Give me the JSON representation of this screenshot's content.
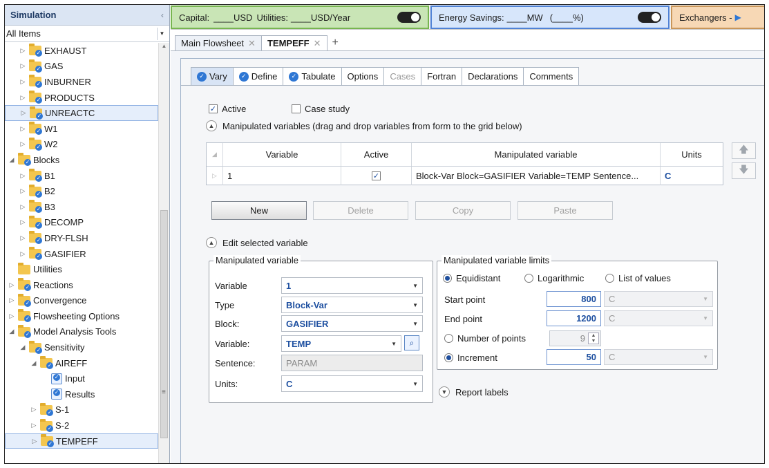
{
  "sidebar": {
    "title": "Simulation",
    "filter": "All Items",
    "tree": [
      {
        "label": "EXHAUST",
        "indent": 1,
        "expander": "▷",
        "icon": "folder-check"
      },
      {
        "label": "GAS",
        "indent": 1,
        "expander": "▷",
        "icon": "folder-check"
      },
      {
        "label": "INBURNER",
        "indent": 1,
        "expander": "▷",
        "icon": "folder-check"
      },
      {
        "label": "PRODUCTS",
        "indent": 1,
        "expander": "▷",
        "icon": "folder-check"
      },
      {
        "label": "UNREACTC",
        "indent": 1,
        "expander": "▷",
        "icon": "folder-check",
        "selected": true
      },
      {
        "label": "W1",
        "indent": 1,
        "expander": "▷",
        "icon": "folder-check"
      },
      {
        "label": "W2",
        "indent": 1,
        "expander": "▷",
        "icon": "folder-check"
      },
      {
        "label": "Blocks",
        "indent": 0,
        "expander": "◢",
        "icon": "folder-check"
      },
      {
        "label": "B1",
        "indent": 1,
        "expander": "▷",
        "icon": "folder-check"
      },
      {
        "label": "B2",
        "indent": 1,
        "expander": "▷",
        "icon": "folder-check"
      },
      {
        "label": "B3",
        "indent": 1,
        "expander": "▷",
        "icon": "folder-check"
      },
      {
        "label": "DECOMP",
        "indent": 1,
        "expander": "▷",
        "icon": "folder-check"
      },
      {
        "label": "DRY-FLSH",
        "indent": 1,
        "expander": "▷",
        "icon": "folder-check"
      },
      {
        "label": "GASIFIER",
        "indent": 1,
        "expander": "▷",
        "icon": "folder-check"
      },
      {
        "label": "Utilities",
        "indent": 0,
        "expander": "",
        "icon": "folder"
      },
      {
        "label": "Reactions",
        "indent": 0,
        "expander": "▷",
        "icon": "folder-check"
      },
      {
        "label": "Convergence",
        "indent": 0,
        "expander": "▷",
        "icon": "folder-check"
      },
      {
        "label": "Flowsheeting Options",
        "indent": 0,
        "expander": "▷",
        "icon": "folder-check"
      },
      {
        "label": "Model Analysis Tools",
        "indent": 0,
        "expander": "◢",
        "icon": "folder-check"
      },
      {
        "label": "Sensitivity",
        "indent": 1,
        "expander": "◢",
        "icon": "folder-check"
      },
      {
        "label": "AIREFF",
        "indent": 2,
        "expander": "◢",
        "icon": "folder-check"
      },
      {
        "label": "Input",
        "indent": 3,
        "expander": "",
        "icon": "doc"
      },
      {
        "label": "Results",
        "indent": 3,
        "expander": "",
        "icon": "doc"
      },
      {
        "label": "S-1",
        "indent": 2,
        "expander": "▷",
        "icon": "folder-check"
      },
      {
        "label": "S-2",
        "indent": 2,
        "expander": "▷",
        "icon": "folder-check"
      },
      {
        "label": "TEMPEFF",
        "indent": 2,
        "expander": "▷",
        "icon": "folder-check",
        "selected": true
      }
    ]
  },
  "topbar": {
    "capital_label": "Capital:",
    "capital_usd": "____USD",
    "utilities_label": "Utilities:",
    "utilities_value": "____USD/Year",
    "energy_label": "Energy Savings:",
    "energy_value": "____MW",
    "energy_pct": "(____%)",
    "exchangers_label": "Exchangers -"
  },
  "doc_tabs": [
    {
      "label": "Main Flowsheet",
      "active": false
    },
    {
      "label": "TEMPEFF",
      "active": true
    }
  ],
  "sub_tabs": [
    {
      "label": "Vary",
      "badge": true,
      "active": true,
      "disabled": false
    },
    {
      "label": "Define",
      "badge": true,
      "active": false,
      "disabled": false
    },
    {
      "label": "Tabulate",
      "badge": true,
      "active": false,
      "disabled": false
    },
    {
      "label": "Options",
      "badge": false,
      "active": false,
      "disabled": false
    },
    {
      "label": "Cases",
      "badge": false,
      "active": false,
      "disabled": true
    },
    {
      "label": "Fortran",
      "badge": false,
      "active": false,
      "disabled": false
    },
    {
      "label": "Declarations",
      "badge": false,
      "active": false,
      "disabled": false
    },
    {
      "label": "Comments",
      "badge": false,
      "active": false,
      "disabled": false
    }
  ],
  "form": {
    "active_label": "Active",
    "active_checked": true,
    "case_study_label": "Case study",
    "case_study_checked": false,
    "manipulated_section": "Manipulated variables (drag and drop variables from form to the grid below)",
    "grid_headers": [
      "Variable",
      "Active",
      "Manipulated variable",
      "Units"
    ],
    "grid_row": {
      "variable": "1",
      "active": true,
      "manipulated": "Block-Var Block=GASIFIER Variable=TEMP Sentence...",
      "units": "C"
    },
    "buttons": {
      "new": "New",
      "delete": "Delete",
      "copy": "Copy",
      "paste": "Paste"
    },
    "edit_section": "Edit selected variable",
    "report_labels": "Report labels"
  },
  "manipulated": {
    "title": "Manipulated variable",
    "variable_label": "Variable",
    "variable_value": "1",
    "type_label": "Type",
    "type_value": "Block-Var",
    "block_label": "Block:",
    "block_value": "GASIFIER",
    "variable2_label": "Variable:",
    "variable2_value": "TEMP",
    "sentence_label": "Sentence:",
    "sentence_value": "PARAM",
    "units_label": "Units:",
    "units_value": "C"
  },
  "limits": {
    "title": "Manipulated variable limits",
    "equidistant": "Equidistant",
    "logarithmic": "Logarithmic",
    "list_of_values": "List of values",
    "start_label": "Start point",
    "start_value": "800",
    "start_unit": "C",
    "end_label": "End point",
    "end_value": "1200",
    "end_unit": "C",
    "npoints_label": "Number of points",
    "npoints_value": "9",
    "increment_label": "Increment",
    "increment_value": "50",
    "increment_unit": "C"
  }
}
